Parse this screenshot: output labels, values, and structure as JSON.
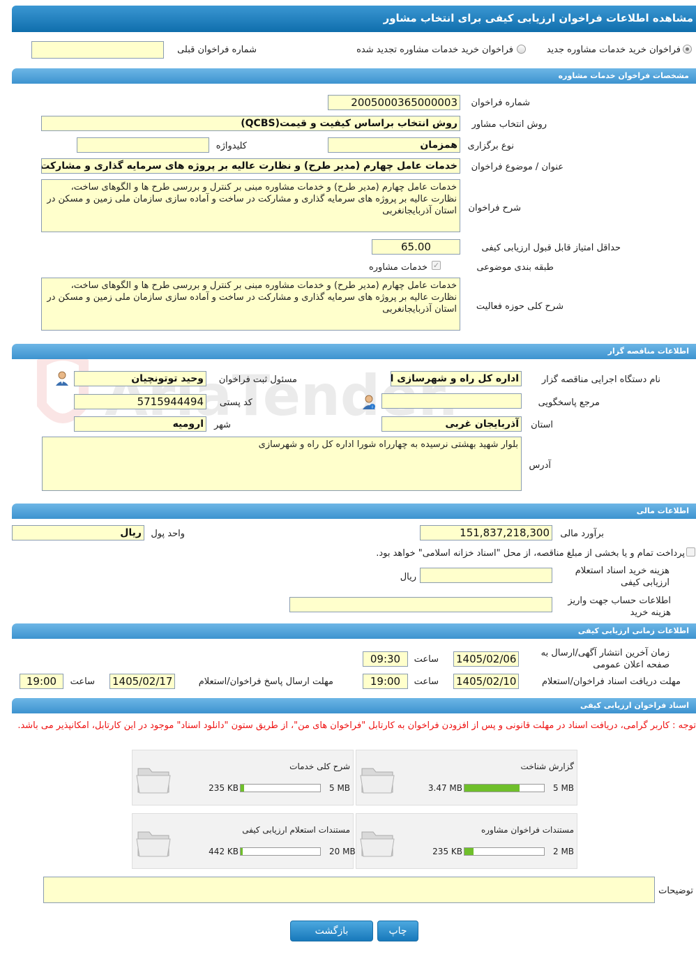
{
  "header": {
    "title": "مشاهده اطلاعات فراخوان ارزیابی کیفی برای انتخاب مشاور"
  },
  "top_options": {
    "radio_new": "فراخوان خرید خدمات مشاوره جدید",
    "radio_renew": "فراخوان خرید خدمات مشاوره تجدید شده",
    "prev_number_label": "شماره فراخوان قبلی",
    "prev_number_value": ""
  },
  "consult_spec": {
    "section_title": "مشخصات فراخوان خدمات مشاوره",
    "number_label": "شماره فراخوان",
    "number_value": "2005000365000003",
    "method_label": "روش انتخاب مشاور",
    "method_value": "روش انتخاب براساس کیفیت و قیمت(QCBS)",
    "holding_label": "نوع برگزاری",
    "holding_value": "همزمان",
    "keyword_label": "کلیدواژه",
    "keyword_value": "",
    "title_label": "عنوان / موضوع فراخوان",
    "title_value": "خدمات عامل چهارم (مدیر طرح) و نظارت عالیه بر پروژه های سرمایه گذاری و مشارکت در",
    "desc_label": "شرح فراخوان",
    "desc_value": "خدمات عامل چهارم (مدیر طرح) و خدمات مشاوره مبنی بر کنترل و بررسی طرح ها و الگوهای ساخت، نظارت عالیه بر پروژه های سرمایه گذاری و مشارکت در ساخت و آماده سازی سازمان ملی زمین و مسکن در استان آذربایجانغربی",
    "min_score_label": "حداقل امتیاز قابل قبول ارزیابی کیفی",
    "min_score_value": "65.00",
    "category_label": "طبقه بندی موضوعی",
    "category_value": "خدمات مشاوره",
    "scope_label": "شرح کلی حوزه فعالیت",
    "scope_value": "خدمات عامل چهارم (مدیر طرح) و خدمات مشاوره مبنی بر کنترل و بررسی طرح ها و الگوهای ساخت، نظارت عالیه بر پروژه های سرمایه گذاری و مشارکت در ساخت و آماده سازی سازمان ملی زمین و مسکن در استان آذربایجانغربی"
  },
  "organizer": {
    "section_title": "اطلاعات مناقصه گزار",
    "org_label": "نام دستگاه اجرایی مناقصه گزار",
    "org_value": "اداره کل راه و شهرسازی استان آذربایجان غربی",
    "registrar_label": "مسئول ثبت فراخوان",
    "registrar_value": "وحید توتونچیان",
    "ref_label": "مرجع پاسخگویی",
    "ref_value": "",
    "postal_label": "کد پستی",
    "postal_value": "5715944494",
    "province_label": "استان",
    "province_value": "آذربایجان غربی",
    "city_label": "شهر",
    "city_value": "ارومیه",
    "address_label": "آدرس",
    "address_value": "بلوار شهید بهشتی نرسیده به چهارراه شورا اداره کل راه و شهرسازی"
  },
  "financial": {
    "section_title": "اطلاعات مالی",
    "estimate_label": "برآورد مالی",
    "estimate_value": "151,837,218,300",
    "currency_label": "واحد پول",
    "currency_value": "ریال",
    "treasury_text": "پرداخت تمام و یا بخشی از مبلغ مناقصه، از محل \"اسناد خزانه اسلامی\" خواهد بود.",
    "doc_fee_label": "هزینه خرید اسناد استعلام ارزیابی کیفی",
    "doc_fee_value": "",
    "doc_fee_unit": "ریال",
    "account_label": "اطلاعات حساب جهت واریز هزینه خرید",
    "account_value": ""
  },
  "timing": {
    "section_title": "اطلاعات زمانی ارزیابی کیفی",
    "publish_label": "زمان آخرین انتشار آگهی/ارسال به صفحه اعلان عمومی",
    "publish_date": "1405/02/06",
    "time_label": "ساعت",
    "publish_time": "09:30",
    "receive_label": "مهلت دریافت اسناد فراخوان/استعلام",
    "receive_date": "1405/02/10",
    "receive_time": "19:00",
    "send_label": "مهلت ارسال پاسخ فراخوان/استعلام",
    "send_date": "1405/02/17",
    "send_time": "19:00"
  },
  "documents": {
    "section_title": "اسناد فراخوان ارزیابی کیفی",
    "notice": "توجه : کاربر گرامی، دریافت اسناد در مهلت قانونی و پس از افزودن فراخوان به کارتابل \"فراخوان های من\"، از طریق ستون \"دانلود اسناد\" موجود در این کارتابل، امکانپذیر می باشد.",
    "cards": [
      {
        "title": "گزارش شناخت",
        "used": "3.47 MB",
        "max": "5 MB",
        "fill": 0.694
      },
      {
        "title": "شرح کلی خدمات",
        "used": "235 KB",
        "max": "5 MB",
        "fill": 0.046
      },
      {
        "title": "مستندات فراخوان مشاوره",
        "used": "235 KB",
        "max": "2 MB",
        "fill": 0.115
      },
      {
        "title": "مستندات استعلام ارزیابی کیفی",
        "used": "442 KB",
        "max": "20 MB",
        "fill": 0.022
      }
    ],
    "desc_label": "توضیحات",
    "desc_value": ""
  },
  "buttons": {
    "print": "چاپ",
    "back": "بازگشت"
  },
  "watermark": "AriaTender.net",
  "colors": {
    "accent": "#1a7abf",
    "field_bg": "#ffffcc",
    "notice": "#ee1111",
    "progress": "#6fbf2b"
  }
}
